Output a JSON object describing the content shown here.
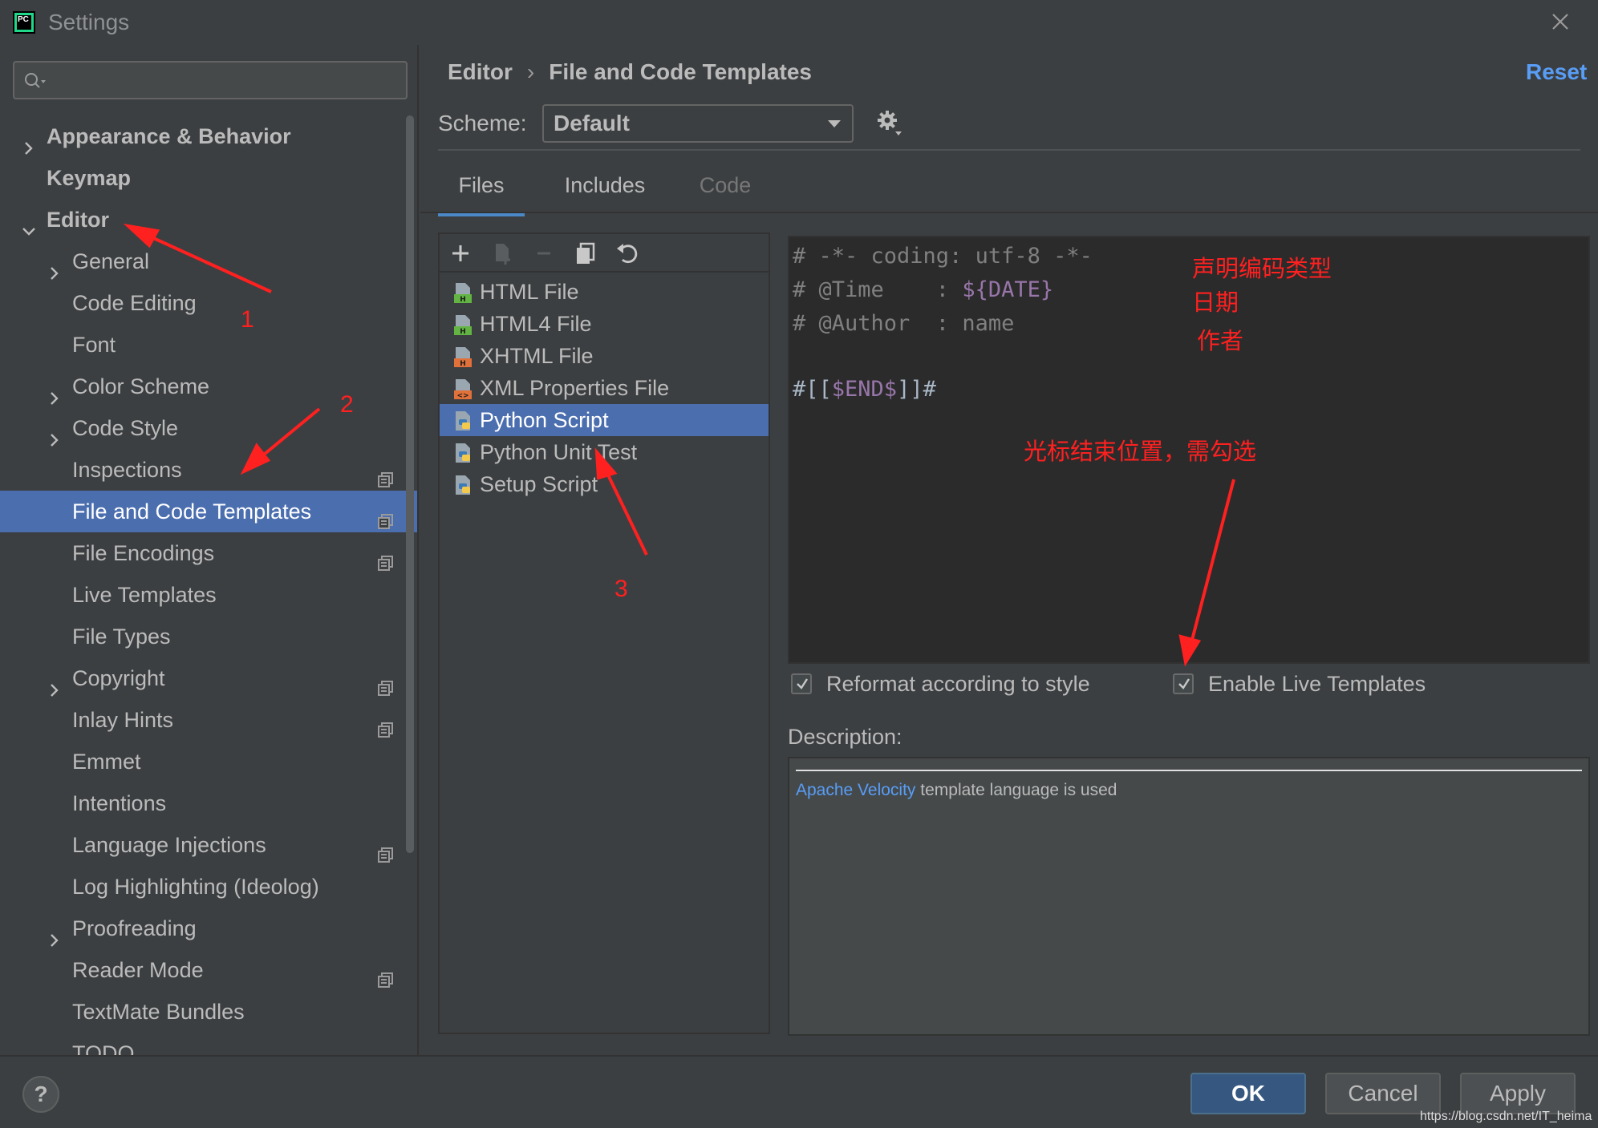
{
  "window": {
    "title": "Settings"
  },
  "sidebar": {
    "search_placeholder": "",
    "items": [
      {
        "label": "Appearance & Behavior",
        "level": "top",
        "expander": "collapsed",
        "project_icon": false
      },
      {
        "label": "Keymap",
        "level": "top",
        "expander": "none",
        "project_icon": false
      },
      {
        "label": "Editor",
        "level": "top",
        "expander": "expanded",
        "project_icon": false
      },
      {
        "label": "General",
        "level": "child",
        "expander": "collapsed",
        "project_icon": false
      },
      {
        "label": "Code Editing",
        "level": "child",
        "expander": "none",
        "project_icon": false
      },
      {
        "label": "Font",
        "level": "child",
        "expander": "none",
        "project_icon": false
      },
      {
        "label": "Color Scheme",
        "level": "child",
        "expander": "collapsed",
        "project_icon": false
      },
      {
        "label": "Code Style",
        "level": "child",
        "expander": "collapsed",
        "project_icon": false
      },
      {
        "label": "Inspections",
        "level": "child",
        "expander": "none",
        "project_icon": true
      },
      {
        "label": "File and Code Templates",
        "level": "child",
        "expander": "none",
        "project_icon": true,
        "selected": true
      },
      {
        "label": "File Encodings",
        "level": "child",
        "expander": "none",
        "project_icon": true
      },
      {
        "label": "Live Templates",
        "level": "child",
        "expander": "none",
        "project_icon": false
      },
      {
        "label": "File Types",
        "level": "child",
        "expander": "none",
        "project_icon": false
      },
      {
        "label": "Copyright",
        "level": "child",
        "expander": "collapsed",
        "project_icon": true
      },
      {
        "label": "Inlay Hints",
        "level": "child",
        "expander": "none",
        "project_icon": true
      },
      {
        "label": "Emmet",
        "level": "child",
        "expander": "none",
        "project_icon": false
      },
      {
        "label": "Intentions",
        "level": "child",
        "expander": "none",
        "project_icon": false
      },
      {
        "label": "Language Injections",
        "level": "child",
        "expander": "none",
        "project_icon": true
      },
      {
        "label": "Log Highlighting (Ideolog)",
        "level": "child",
        "expander": "none",
        "project_icon": false
      },
      {
        "label": "Proofreading",
        "level": "child",
        "expander": "collapsed",
        "project_icon": false
      },
      {
        "label": "Reader Mode",
        "level": "child",
        "expander": "none",
        "project_icon": true
      },
      {
        "label": "TextMate Bundles",
        "level": "child",
        "expander": "none",
        "project_icon": false
      },
      {
        "label": "TODO",
        "level": "child",
        "expander": "none",
        "project_icon": false
      }
    ]
  },
  "main": {
    "breadcrumb": [
      "Editor",
      "File and Code Templates"
    ],
    "breadcrumb_separator": "›",
    "reset_label": "Reset",
    "scheme_label": "Scheme:",
    "scheme_value": "Default",
    "tabs": [
      {
        "label": "Files",
        "state": "active"
      },
      {
        "label": "Includes",
        "state": "normal"
      },
      {
        "label": "Code",
        "state": "disabled"
      }
    ],
    "templates": [
      {
        "label": "HTML File",
        "icon": "html-file-icon"
      },
      {
        "label": "HTML4 File",
        "icon": "html-file-icon"
      },
      {
        "label": "XHTML File",
        "icon": "xhtml-file-icon"
      },
      {
        "label": "XML Properties File",
        "icon": "xml-file-icon"
      },
      {
        "label": "Python Script",
        "icon": "python-file-icon",
        "selected": true
      },
      {
        "label": "Python Unit Test",
        "icon": "python-file-icon"
      },
      {
        "label": "Setup Script",
        "icon": "python-file-icon"
      }
    ],
    "code": {
      "line1": "# -*- coding: utf-8 -*-",
      "line2_prefix": "# @Time    : ",
      "line2_var": "${DATE}",
      "line3": "# @Author  : name",
      "line5_prefix": "#[[",
      "line5_var": "$END$",
      "line5_suffix": "]]#"
    },
    "reformat_label": "Reformat according to style",
    "reformat_checked": true,
    "live_templates_label": "Enable Live Templates",
    "live_templates_checked": true,
    "description_label": "Description:",
    "description_link": "Apache Velocity",
    "description_text": " template language is used"
  },
  "footer": {
    "help_label": "?",
    "ok_label": "OK",
    "cancel_label": "Cancel",
    "apply_label": "Apply",
    "watermark": "https://blog.csdn.net/IT_heima"
  },
  "annotations": {
    "encoding_note": "声明编码类型",
    "date_note": "日期",
    "author_note": "作者",
    "cursor_note": "光标结束位置，需勾选",
    "num1": "1",
    "num2": "2",
    "num3": "3"
  },
  "colors": {
    "selection": "#4b6eaf",
    "link": "#589df6",
    "annotation": "#ff2020",
    "code_variable": "#9876aa",
    "code_comment": "#808080"
  }
}
